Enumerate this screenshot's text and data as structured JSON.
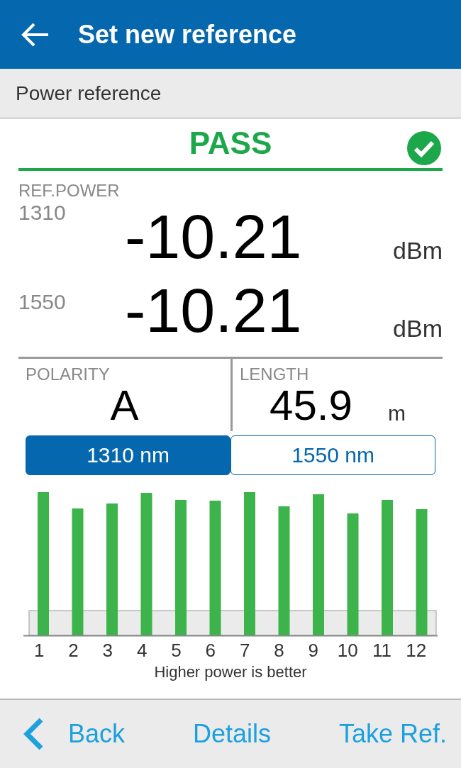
{
  "header": {
    "title": "Set new reference"
  },
  "section": {
    "title": "Power reference"
  },
  "result": {
    "status": "PASS",
    "passed": true
  },
  "ref_power": {
    "label": "REF.POWER",
    "rows": [
      {
        "wavelength": "1310",
        "value": "-10.21",
        "unit": "dBm"
      },
      {
        "wavelength": "1550",
        "value": "-10.21",
        "unit": "dBm"
      }
    ]
  },
  "polarity": {
    "label": "POLARITY",
    "value": "A"
  },
  "length": {
    "label": "LENGTH",
    "value": "45.9",
    "unit": "m"
  },
  "wavelength_tabs": [
    {
      "label": "1310 nm",
      "selected": true
    },
    {
      "label": "1550 nm",
      "selected": false
    }
  ],
  "fiber_chart": {
    "labels": [
      "1",
      "2",
      "3",
      "4",
      "5",
      "6",
      "7",
      "8",
      "9",
      "10",
      "11",
      "12"
    ],
    "caption": "Higher power is better"
  },
  "footer": {
    "buttons": [
      {
        "kind": "back",
        "label": "Back"
      },
      {
        "kind": "plain",
        "label": "Details"
      },
      {
        "kind": "plain",
        "label": "Take Ref."
      }
    ]
  }
}
